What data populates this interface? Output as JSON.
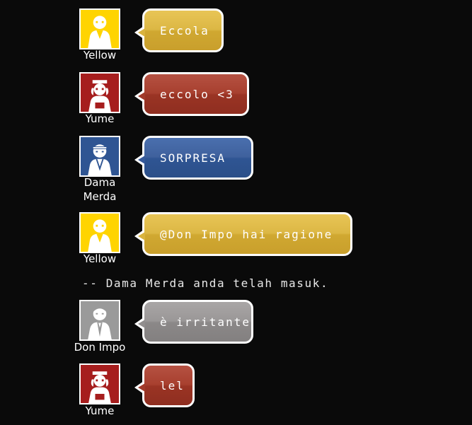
{
  "messages": [
    {
      "user": "Yellow",
      "text": "Eccola",
      "avatar_icon": "user-female-icon",
      "color": "#ffd400"
    },
    {
      "user": "Yume",
      "text": "eccolo <3",
      "avatar_icon": "nurse-icon",
      "color": "#a61d1d"
    },
    {
      "user": "Dama Merda",
      "text": "SORPRESA",
      "avatar_icon": "karate-icon",
      "color": "#2f5593"
    },
    {
      "user": "Yellow",
      "text": "@Don Impo hai ragione",
      "avatar_icon": "user-female-icon",
      "color": "#ffd400"
    },
    {
      "user": "Don Impo",
      "text": "è irritante",
      "avatar_icon": "man-suit-icon",
      "color": "#9a9a9a"
    },
    {
      "user": "Yume",
      "text": "lel",
      "avatar_icon": "nurse-icon",
      "color": "#a61d1d"
    }
  ],
  "system_message": "-- Dama Merda anda telah masuk."
}
